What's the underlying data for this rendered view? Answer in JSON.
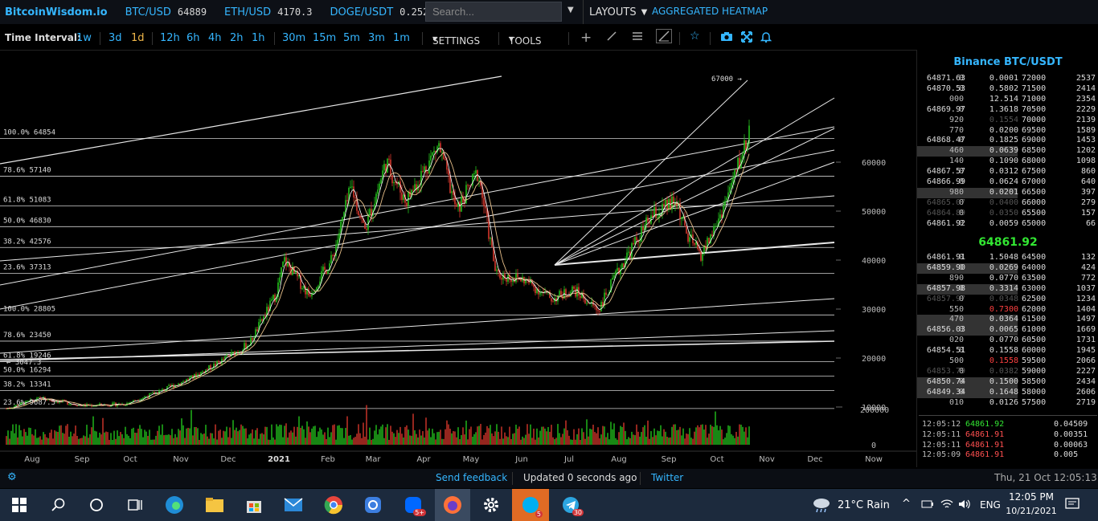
{
  "header": {
    "brand": "BitcoinWisdom.io",
    "tickers": [
      {
        "name": "BTC/USD",
        "value": "64889"
      },
      {
        "name": "ETH/USD",
        "value": "4170.3"
      },
      {
        "name": "DOGE/USDT",
        "value": "0.2522"
      }
    ],
    "search_placeholder": "Search...",
    "layouts_label": "LAYOUTS",
    "heatmap_label": "AGGREGATED HEATMAP"
  },
  "toolbar": {
    "time_interval_label": "Time Interval:",
    "intervals": [
      "1w",
      "3d",
      "1d",
      "12h",
      "6h",
      "4h",
      "2h",
      "1h",
      "30m",
      "15m",
      "5m",
      "3m",
      "1m"
    ],
    "active_interval": "1d",
    "settings_label": "SETTINGS",
    "tools_label": "TOOLS",
    "icons": [
      "crosshair-icon",
      "line-icon",
      "menu-icon",
      "draw-icon",
      "star-icon",
      "camera-icon",
      "expand-icon",
      "bell-icon"
    ]
  },
  "chart_data": {
    "type": "candlestick",
    "title": "",
    "price_ticks": [
      60000,
      50000,
      40000,
      30000,
      20000,
      10000
    ],
    "volume_ticks": [
      "200000",
      "0"
    ],
    "x_labels": [
      "Aug",
      "Sep",
      "Oct",
      "Nov",
      "Dec",
      "2021",
      "Feb",
      "Mar",
      "Apr",
      "May",
      "Jun",
      "Jul",
      "Aug",
      "Sep",
      "Oct",
      "Nov",
      "Dec",
      "Now"
    ],
    "ylim": [
      8000,
      68000
    ],
    "grid": false,
    "fib_levels_upper": [
      {
        "label": "100.0% 64854",
        "price": 64854
      },
      {
        "label": "78.6% 57140",
        "price": 57140
      },
      {
        "label": "61.8% 51083",
        "price": 51083
      },
      {
        "label": "50.0% 46830",
        "price": 46830
      },
      {
        "label": "38.2% 42576",
        "price": 42576
      },
      {
        "label": "23.6% 37313",
        "price": 37313
      }
    ],
    "fib_levels_lower": [
      {
        "label": "100.0% 28805",
        "price": 28805
      },
      {
        "label": "78.6% 23450",
        "price": 23450
      },
      {
        "label": "61.8% 19246",
        "price": 19246
      },
      {
        "label": "50.0% 16294",
        "price": 16294
      },
      {
        "label": "38.2% 13341",
        "price": 13341
      },
      {
        "label": "23.6% 9687.5",
        "price": 9687.5
      }
    ],
    "low_label": "← 3047.3",
    "high_annotation": "67000 →",
    "price_path": [
      [
        "2020-07-25",
        9700
      ],
      [
        "2020-08-15",
        11800
      ],
      [
        "2020-09-10",
        10300
      ],
      [
        "2020-10-05",
        10600
      ],
      [
        "2020-10-25",
        13000
      ],
      [
        "2020-11-15",
        16000
      ],
      [
        "2020-12-01",
        19000
      ],
      [
        "2020-12-20",
        23000
      ],
      [
        "2021-01-05",
        33000
      ],
      [
        "2021-01-10",
        40000
      ],
      [
        "2021-01-25",
        33000
      ],
      [
        "2021-02-08",
        40000
      ],
      [
        "2021-02-20",
        55000
      ],
      [
        "2021-02-28",
        46000
      ],
      [
        "2021-03-13",
        60000
      ],
      [
        "2021-03-25",
        52000
      ],
      [
        "2021-04-14",
        63500
      ],
      [
        "2021-04-25",
        50000
      ],
      [
        "2021-05-08",
        58000
      ],
      [
        "2021-05-19",
        37000
      ],
      [
        "2021-06-05",
        36000
      ],
      [
        "2021-06-22",
        32000
      ],
      [
        "2021-07-05",
        34000
      ],
      [
        "2021-07-20",
        29800
      ],
      [
        "2021-08-05",
        40000
      ],
      [
        "2021-08-22",
        49000
      ],
      [
        "2021-09-06",
        52000
      ],
      [
        "2021-09-12",
        45000
      ],
      [
        "2021-09-21",
        41000
      ],
      [
        "2021-10-01",
        48000
      ],
      [
        "2021-10-10",
        56000
      ],
      [
        "2021-10-20",
        66000
      ]
    ]
  },
  "orderbook": {
    "title": "Binance BTC/USDT",
    "asks": [
      [
        "64871.63",
        "0",
        "0.0001",
        "72000",
        "2537"
      ],
      [
        "64870.53",
        "0",
        "0.5802",
        "71500",
        "2414"
      ],
      [
        "",
        "000",
        "12.514",
        "71000",
        "2354"
      ],
      [
        "64869.97",
        "0",
        "1.3618",
        "70500",
        "2229"
      ],
      [
        "",
        "920",
        "0.1554",
        "70000",
        "2139"
      ],
      [
        "",
        "770",
        "0.0200",
        "69500",
        "1589"
      ],
      [
        "64868.47",
        "0",
        "0.1825",
        "69000",
        "1453"
      ],
      [
        "",
        "460",
        "0.0639",
        "68500",
        "1202"
      ],
      [
        "",
        "140",
        "0.1090",
        "68000",
        "1098"
      ],
      [
        "64867.57",
        "0",
        "0.0312",
        "67500",
        "860"
      ],
      [
        "64866.99",
        "0",
        "0.0624",
        "67000",
        "640"
      ],
      [
        "",
        "980",
        "0.0201",
        "66500",
        "397"
      ],
      [
        "64865.07",
        "0",
        "0.0400",
        "66000",
        "279"
      ],
      [
        "64864.89",
        "0",
        "0.0350",
        "65500",
        "157"
      ],
      [
        "64861.92",
        "0",
        "0.0059",
        "65000",
        "66"
      ]
    ],
    "mid_price": "64861.92",
    "bids": [
      [
        "64861.91",
        "0",
        "1.5048",
        "64500",
        "132"
      ],
      [
        "64859.90",
        "0",
        "0.0269",
        "64000",
        "424"
      ],
      [
        "",
        "890",
        "0.0770",
        "63500",
        "772"
      ],
      [
        "64857.98",
        "0",
        "0.3314",
        "63000",
        "1037"
      ],
      [
        "64857.97",
        "0",
        "0.0348",
        "62500",
        "1234"
      ],
      [
        "",
        "550",
        "0.7300",
        "62000",
        "1404"
      ],
      [
        "",
        "470",
        "0.0364",
        "61500",
        "1497"
      ],
      [
        "64856.03",
        "0",
        "0.0065",
        "61000",
        "1669"
      ],
      [
        "",
        "020",
        "0.0770",
        "60500",
        "1731"
      ],
      [
        "64854.51",
        "0",
        "0.1558",
        "60000",
        "1945"
      ],
      [
        "",
        "500",
        "0.1558",
        "59500",
        "2066"
      ],
      [
        "64853.79",
        "0",
        "0.0382",
        "59000",
        "2227"
      ],
      [
        "64850.74",
        "0",
        "0.1500",
        "58500",
        "2434"
      ],
      [
        "64849.34",
        "0",
        "0.1648",
        "58000",
        "2606"
      ],
      [
        "",
        "010",
        "0.0126",
        "57500",
        "2719"
      ]
    ],
    "trades": [
      [
        "12:05:12",
        "64861.92",
        "0.04509"
      ],
      [
        "12:05:11",
        "64861.91",
        "0.00351"
      ],
      [
        "12:05:11",
        "64861.91",
        "0.00063"
      ],
      [
        "12:05:09",
        "64861.91",
        "0.005"
      ]
    ]
  },
  "status": {
    "feedback": "Send feedback",
    "updated": "Updated 0 seconds ago",
    "twitter": "Twitter",
    "datetime": "Thu, 21 Oct 12:05:13"
  },
  "taskbar": {
    "weather": "21°C Rain",
    "lang": "ENG",
    "time": "12:05 PM",
    "date": "10/21/2021",
    "badges": [
      "5+",
      "5",
      "30"
    ]
  },
  "colors": {
    "accent": "#35b6ff",
    "up": "#23c11c",
    "down": "#d5372c",
    "mid_price": "#32e632",
    "fast_ma": "#ffffff",
    "slow_ma": "#e8c08a"
  }
}
